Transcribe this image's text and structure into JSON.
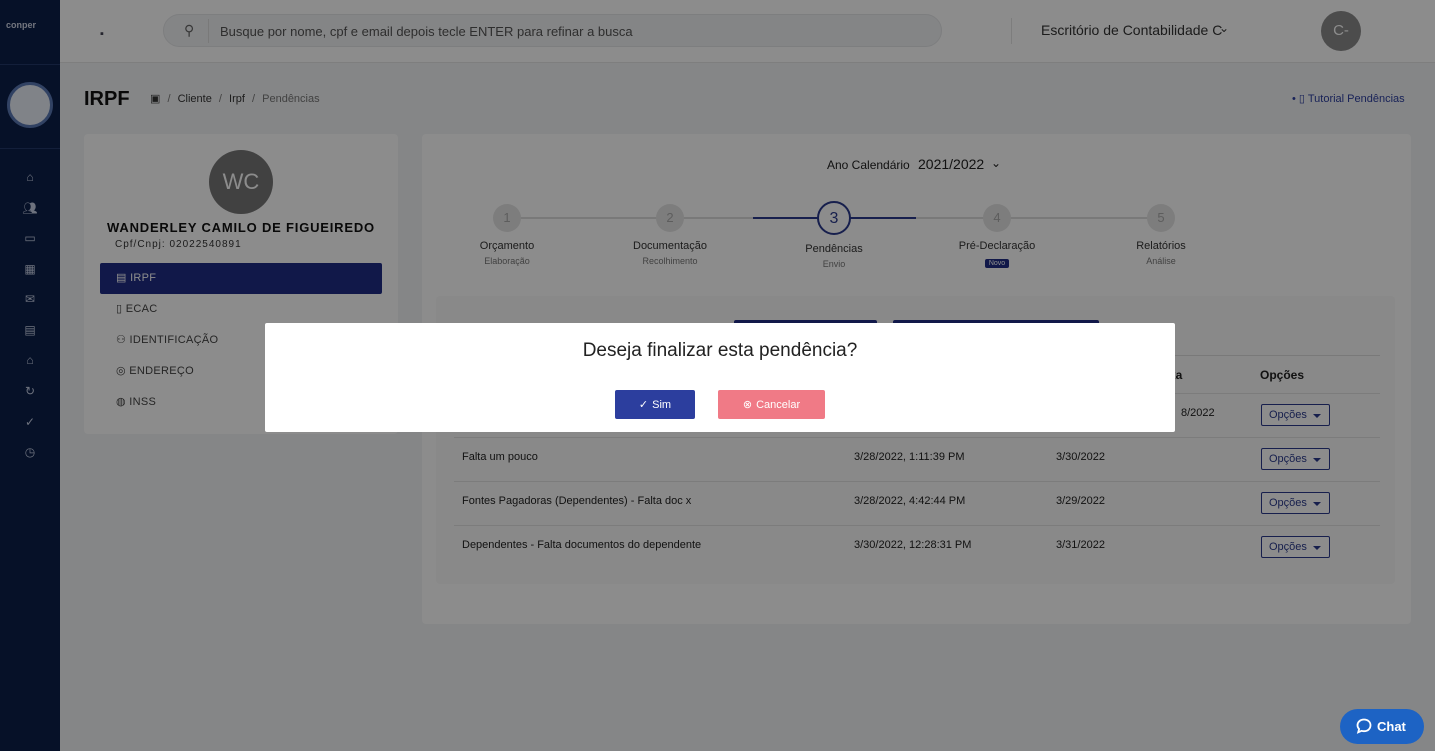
{
  "sidebar": {
    "logo_text": "conper",
    "icons": [
      "home-icon",
      "users-icon",
      "card-icon",
      "chart-icon",
      "mail-icon",
      "file-icon",
      "bank-icon",
      "sync-icon",
      "user-check-icon",
      "clock-icon"
    ]
  },
  "topbar": {
    "search_placeholder": "Busque por nome, cpf e email depois tecle ENTER para refinar a busca",
    "office_name": "Escritório de Contabilidade C",
    "avatar_initials": "C-"
  },
  "page": {
    "title": "IRPF",
    "breadcrumb": [
      "Cliente",
      "Irpf",
      "Pendências"
    ],
    "tutorial_link": "Tutorial Pendências"
  },
  "profile": {
    "initials": "WC",
    "name": "WANDERLEY CAMILO DE FIGUEIREDO",
    "cpf": "Cpf/Cnpj: 02022540891",
    "menu": [
      {
        "label": "IRPF",
        "icon": "file-icon",
        "active": true
      },
      {
        "label": "ECAC",
        "icon": "tablet-icon",
        "active": false
      },
      {
        "label": "IDENTIFICAÇÃO",
        "icon": "user-icon",
        "active": false
      },
      {
        "label": "ENDEREÇO",
        "icon": "pin-icon",
        "active": false
      },
      {
        "label": "INSS",
        "icon": "globe-icon",
        "active": false
      }
    ]
  },
  "year": {
    "label": "Ano Calendário",
    "value": "2021/2022"
  },
  "steps": [
    {
      "number": "1",
      "title": "Orçamento",
      "subtitle": "Elaboração"
    },
    {
      "number": "2",
      "title": "Documentação",
      "subtitle": "Recolhimento"
    },
    {
      "number": "3",
      "title": "Pendências",
      "subtitle": "Envio"
    },
    {
      "number": "4",
      "title": "Pré-Declaração",
      "badge": "Novo"
    },
    {
      "number": "5",
      "title": "Relatórios",
      "subtitle": "Análise"
    }
  ],
  "table": {
    "headers": [
      "xa",
      "Opções"
    ],
    "first_row_partial_date": "8/2022",
    "options_label": "Opções",
    "rows": [
      {
        "description": "Falta um pouco",
        "created": "3/28/2022, 1:11:39 PM",
        "deadline": "3/30/2022"
      },
      {
        "description": "Fontes Pagadoras (Dependentes) - Falta doc x",
        "created": "3/28/2022, 4:42:44 PM",
        "deadline": "3/29/2022"
      },
      {
        "description": "Dependentes - Falta documentos do dependente",
        "created": "3/30/2022, 12:28:31 PM",
        "deadline": "3/31/2022"
      }
    ]
  },
  "modal": {
    "title": "Deseja finalizar esta pendência?",
    "confirm_label": "Sim",
    "cancel_label": "Cancelar"
  },
  "chat": {
    "label": "Chat"
  },
  "colors": {
    "primary": "#1f2d86",
    "cancel": "#f07a86",
    "sidebar": "#0b1f4a",
    "chat": "#1d63c4"
  }
}
